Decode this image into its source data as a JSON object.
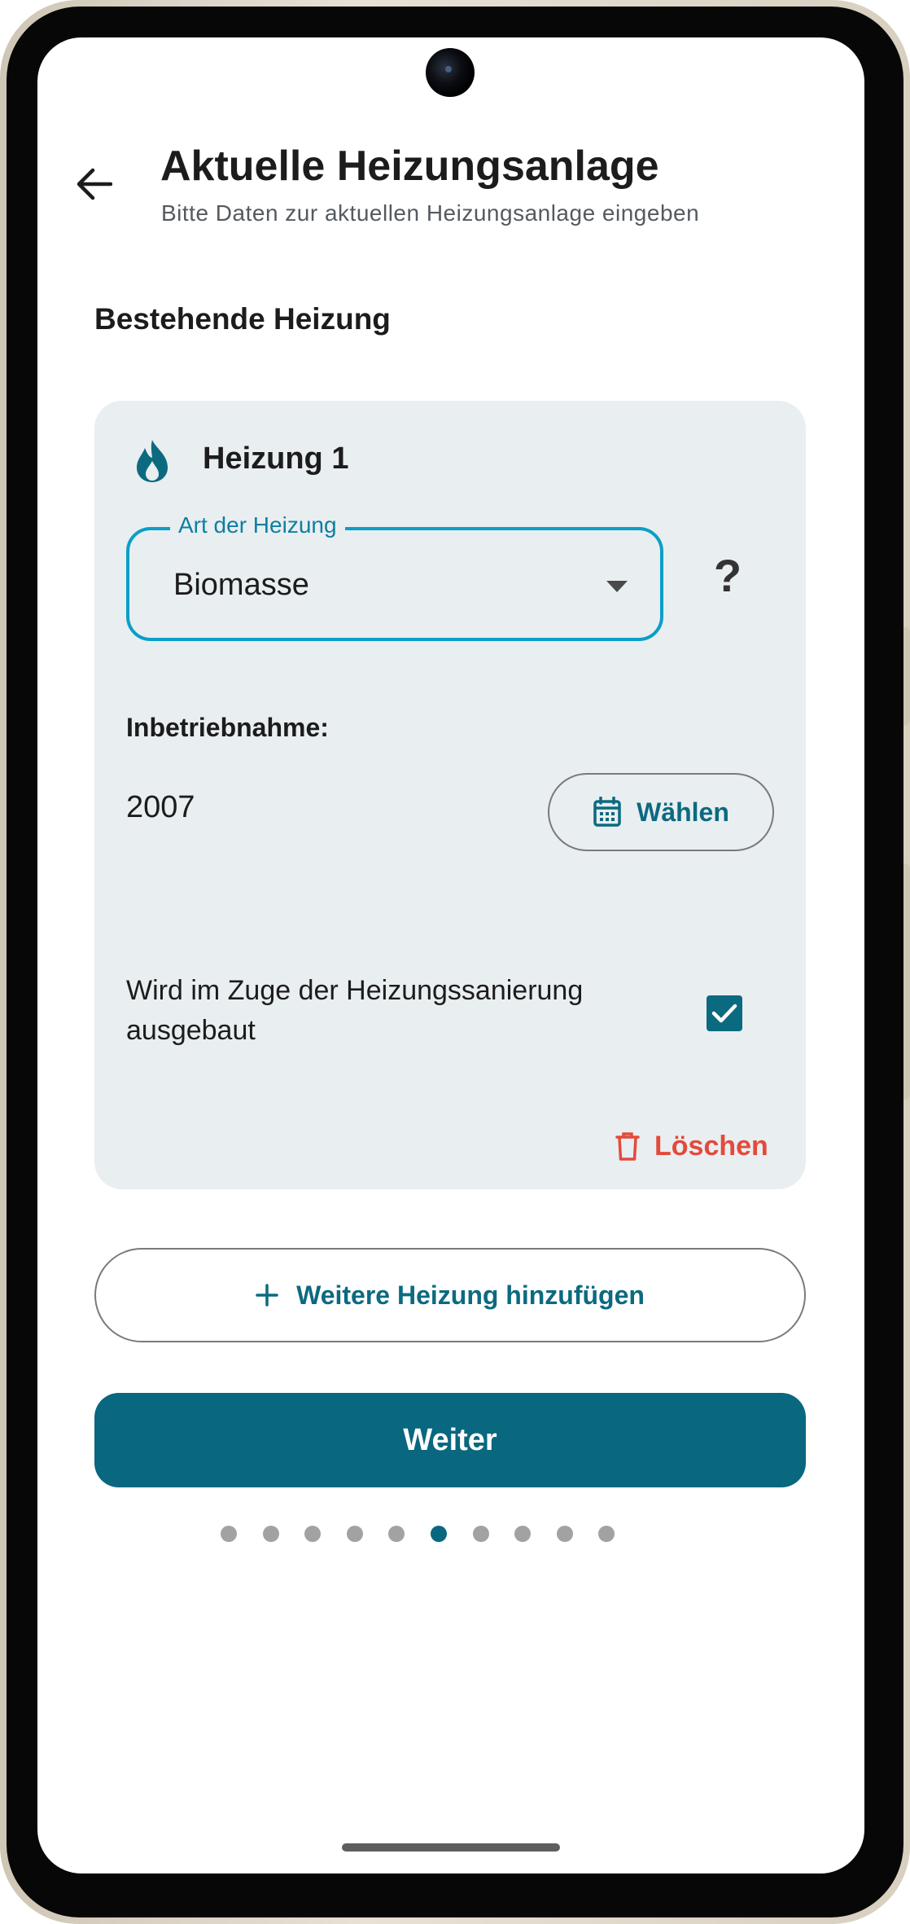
{
  "header": {
    "title": "Aktuelle Heizungsanlage",
    "subtitle": "Bitte Daten zur aktuellen Heizungsanlage eingeben",
    "back_icon": "arrow-left-icon"
  },
  "section": {
    "title": "Bestehende Heizung"
  },
  "heater_card": {
    "icon": "flame-icon",
    "title": "Heizung 1",
    "heating_type": {
      "label": "Art der Heizung",
      "value": "Biomasse",
      "dropdown_icon": "dropdown-arrow-icon"
    },
    "help": "?",
    "commissioning": {
      "label": "Inbetriebnahme:",
      "value": "2007",
      "choose_label": "Wählen",
      "choose_icon": "calendar-icon"
    },
    "removal": {
      "text": "Wird im Zuge der Heizungssanierung ausgebaut",
      "checked": true
    },
    "delete_label": "Löschen",
    "delete_icon": "trash-icon"
  },
  "actions": {
    "add_label": "Weitere Heizung hinzufügen",
    "add_icon": "plus-icon",
    "next_label": "Weiter"
  },
  "progress": {
    "total_steps": 10,
    "current_step": 6
  },
  "colors": {
    "primary": "#09677f",
    "focus_border": "#0a9fc6",
    "danger": "#e34a3c",
    "card_bg": "#e9eef1",
    "dot_inactive": "#a2a2a2"
  }
}
